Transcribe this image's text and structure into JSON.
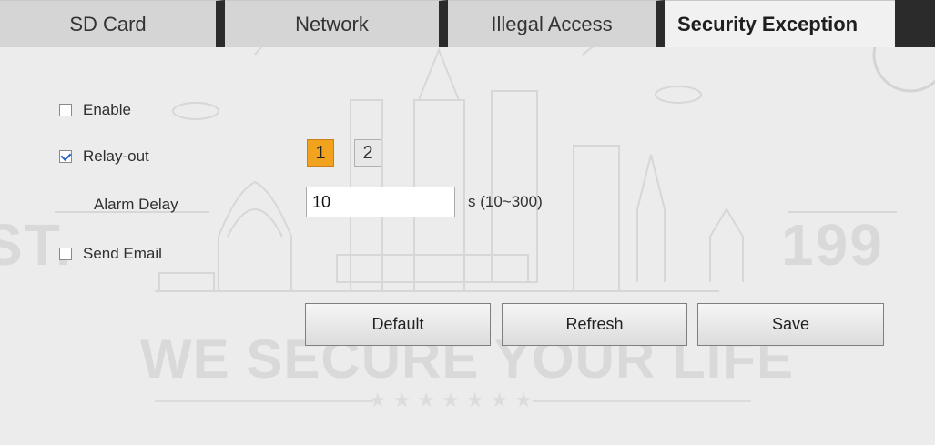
{
  "tabs": [
    {
      "label": "SD Card"
    },
    {
      "label": "Network"
    },
    {
      "label": "Illegal Access"
    },
    {
      "label": "Security Exception",
      "active": true
    }
  ],
  "form": {
    "enable": {
      "label": "Enable",
      "checked": false
    },
    "relay_out": {
      "label": "Relay-out",
      "checked": true,
      "buttons": [
        "1",
        "2"
      ],
      "selected": "1"
    },
    "alarm_delay": {
      "label": "Alarm Delay",
      "value": "10",
      "unit": "s (10~300)"
    },
    "send_email": {
      "label": "Send Email",
      "checked": false
    }
  },
  "actions": {
    "default_label": "Default",
    "refresh_label": "Refresh",
    "save_label": "Save"
  },
  "watermark": {
    "left_text": "ST.",
    "right_text": "199",
    "slogan": "WE SECURE YOUR LIFE"
  },
  "colors": {
    "accent": "#f2a31e",
    "tab_separator": "#2b2b2b",
    "background": "#ececec"
  }
}
